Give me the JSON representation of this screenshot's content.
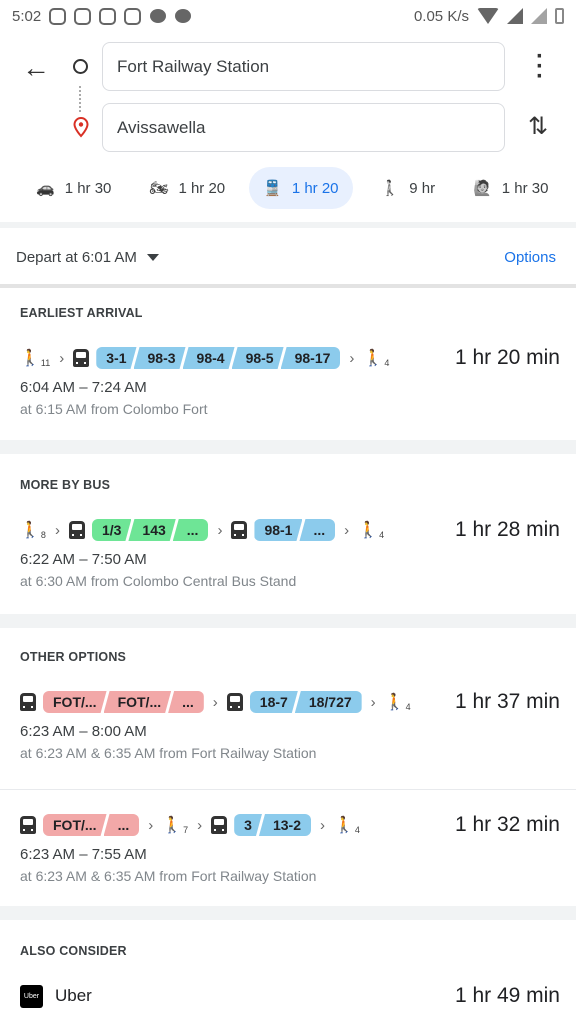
{
  "status": {
    "time": "5:02",
    "net_speed": "0.05 K/s"
  },
  "search": {
    "origin": "Fort Railway Station",
    "destination": "Avissawella"
  },
  "modes": [
    {
      "icon": "car-icon",
      "label": "1 hr 30",
      "selected": false
    },
    {
      "icon": "motorcycle-icon",
      "label": "1 hr 20",
      "selected": false
    },
    {
      "icon": "transit-icon",
      "label": "1 hr 20",
      "selected": true
    },
    {
      "icon": "walk-icon",
      "label": "9 hr",
      "selected": false
    },
    {
      "icon": "ride-hail-icon",
      "label": "1 hr 30",
      "selected": false
    }
  ],
  "depart": {
    "label": "Depart at 6:01 AM",
    "options": "Options"
  },
  "colors": {
    "blue_chip": "#8ccbec",
    "green_chip": "#6ee596",
    "red_chip": "#f2a8a8",
    "accent": "#1a73e8"
  },
  "sections": [
    {
      "title": "EARLIEST ARRIVAL",
      "routes": [
        {
          "steps": [
            {
              "type": "walk",
              "n": "11"
            },
            {
              "type": "bus",
              "color": "blue",
              "labels": [
                "3-1",
                "98-3",
                "98-4",
                "98-5",
                "98-17"
              ]
            },
            {
              "type": "walk",
              "n": "4"
            }
          ],
          "duration": "1 hr 20 min",
          "times": "6:04 AM – 7:24 AM",
          "from": "at 6:15 AM from Colombo Fort"
        }
      ]
    },
    {
      "title": "MORE BY BUS",
      "routes": [
        {
          "steps": [
            {
              "type": "walk",
              "n": "8"
            },
            {
              "type": "bus",
              "color": "green",
              "labels": [
                "1/3",
                "143",
                "..."
              ]
            },
            {
              "type": "bus",
              "color": "blue",
              "labels": [
                "98-1",
                "..."
              ]
            },
            {
              "type": "walk",
              "n": "4"
            }
          ],
          "duration": "1 hr 28 min",
          "times": "6:22 AM – 7:50 AM",
          "from": "at 6:30 AM from Colombo Central Bus Stand"
        }
      ]
    },
    {
      "title": "OTHER OPTIONS",
      "routes": [
        {
          "steps": [
            {
              "type": "train",
              "color": "red",
              "labels": [
                "FOT/...",
                "FOT/...",
                "..."
              ]
            },
            {
              "type": "bus",
              "color": "blue",
              "labels": [
                "18-7",
                "18/727"
              ]
            },
            {
              "type": "walk",
              "n": "4"
            }
          ],
          "duration": "1 hr 37 min",
          "times": "6:23 AM – 8:00 AM",
          "from": "at 6:23 AM & 6:35 AM from Fort Railway Station"
        },
        {
          "steps": [
            {
              "type": "train",
              "color": "red",
              "labels": [
                "FOT/...",
                "..."
              ]
            },
            {
              "type": "walk",
              "n": "7"
            },
            {
              "type": "bus",
              "color": "blue",
              "labels": [
                "3",
                "13-2"
              ]
            },
            {
              "type": "walk",
              "n": "4"
            }
          ],
          "duration": "1 hr 32 min",
          "times": "6:23 AM – 7:55 AM",
          "from": "at 6:23 AM & 6:35 AM from Fort Railway Station"
        }
      ]
    },
    {
      "title": "ALSO CONSIDER",
      "routes": []
    }
  ],
  "uber": {
    "logo": "Uber",
    "label": "Uber",
    "duration": "1 hr 49 min"
  }
}
